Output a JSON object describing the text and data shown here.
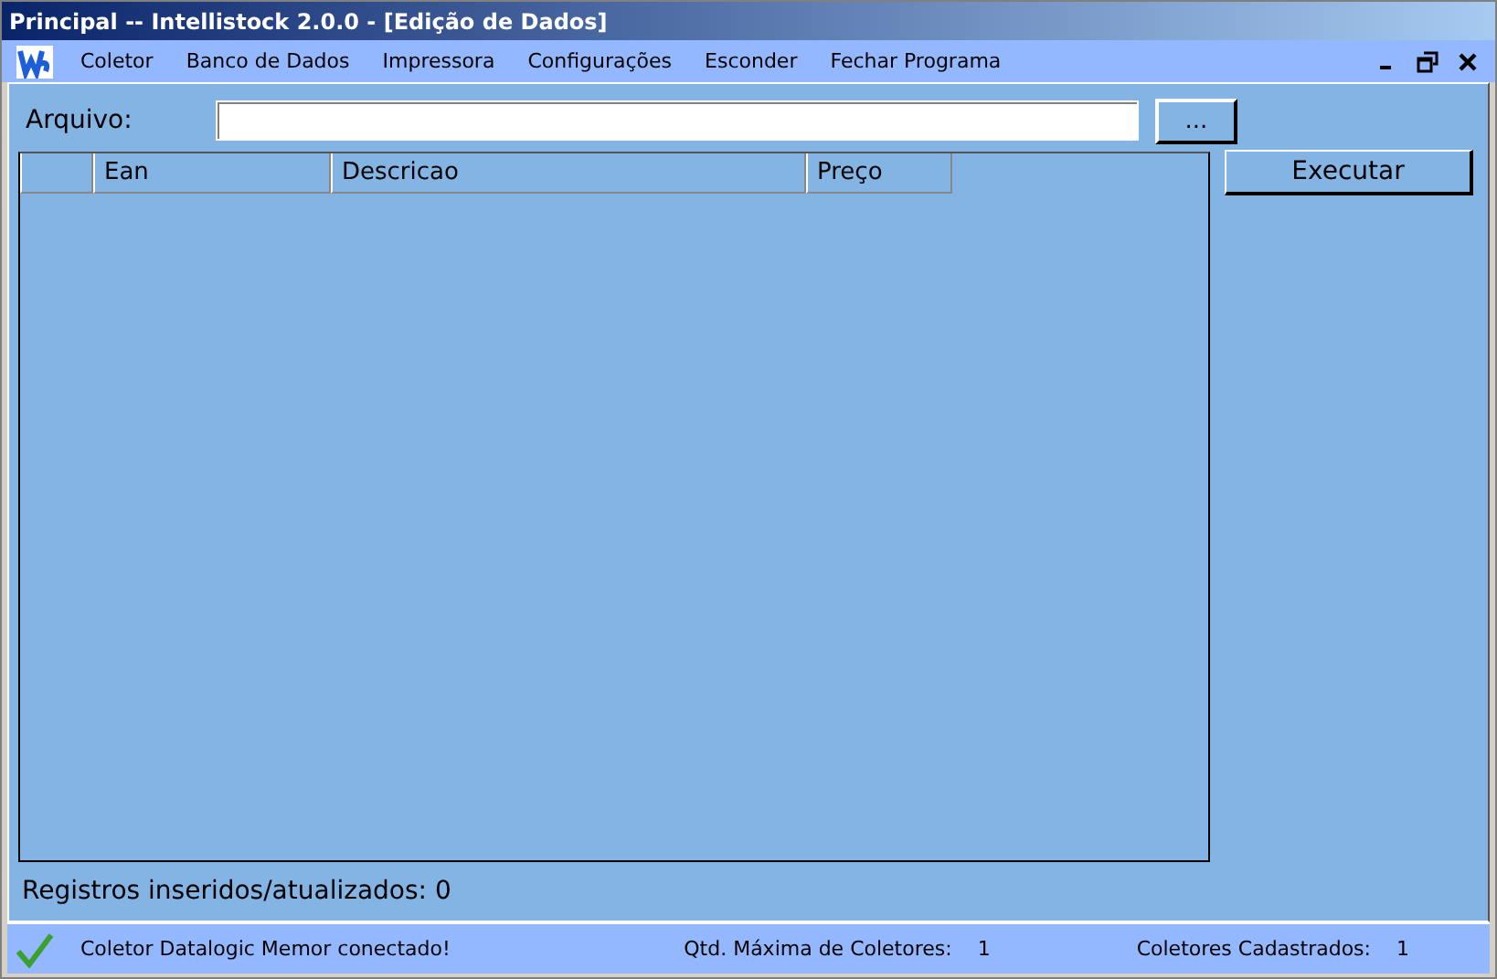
{
  "window": {
    "title": "Principal -- Intellistock 2.0.0 - [Edição de Dados]"
  },
  "menu": [
    "Coletor",
    "Banco de Dados",
    "Impressora",
    "Configurações",
    "Esconder",
    "Fechar Programa"
  ],
  "file": {
    "label": "Arquivo:",
    "browse": "..."
  },
  "table": {
    "columns": [
      "Ean",
      "Descricao",
      "Preço"
    ]
  },
  "execute": "Executar",
  "records": "Registros inseridos/atualizados: 0",
  "status_bar": {
    "message": "Coletor Datalogic Memor conectado!",
    "max_label": "Qtd. Máxima de Coletores:",
    "max_value": "1",
    "registered_label": "Coletores Cadastrados:",
    "registered_value": "1"
  }
}
